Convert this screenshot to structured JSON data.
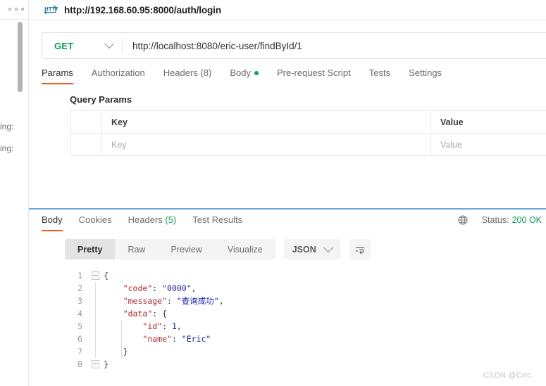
{
  "window": {
    "title": "http://192.168.60.95:8000/auth/login",
    "http_badge_label": "HTTP",
    "rail_menu_icon": "more-horizontal-icon",
    "truncated_left_labels": [
      "ing:",
      "ing:"
    ]
  },
  "request": {
    "method": "GET",
    "url": "http://localhost:8080/eric-user/findById/1",
    "tabs": [
      {
        "label": "Params",
        "active": true,
        "dot": false
      },
      {
        "label": "Authorization",
        "active": false,
        "dot": false
      },
      {
        "label": "Headers (8)",
        "active": false,
        "dot": false
      },
      {
        "label": "Body",
        "active": false,
        "dot": true
      },
      {
        "label": "Pre-request Script",
        "active": false,
        "dot": false
      },
      {
        "label": "Tests",
        "active": false,
        "dot": false
      },
      {
        "label": "Settings",
        "active": false,
        "dot": false
      }
    ],
    "query_params": {
      "section_title": "Query Params",
      "columns": [
        "Key",
        "Value"
      ],
      "rows": [
        {
          "key_placeholder": "Key",
          "value_placeholder": "Value"
        }
      ]
    }
  },
  "response": {
    "tabs": [
      {
        "label": "Body",
        "active": true
      },
      {
        "label": "Cookies",
        "active": false
      },
      {
        "label": "Headers",
        "count": "(5)",
        "active": false
      },
      {
        "label": "Test Results",
        "active": false
      }
    ],
    "status_label": "Status:",
    "status_code": "200 OK",
    "globe_icon": "globe-icon",
    "view_modes": [
      {
        "label": "Pretty",
        "active": true
      },
      {
        "label": "Raw",
        "active": false
      },
      {
        "label": "Preview",
        "active": false
      },
      {
        "label": "Visualize",
        "active": false
      }
    ],
    "format": "JSON",
    "wrap_icon": "wrap-text-icon",
    "code": {
      "line_numbers": [
        "1",
        "2",
        "3",
        "4",
        "5",
        "6",
        "7",
        "8"
      ],
      "lines": [
        [
          {
            "t": "{",
            "c": "p"
          }
        ],
        [
          {
            "t": "    ",
            "c": "p"
          },
          {
            "t": "\"code\"",
            "c": "k"
          },
          {
            "t": ": ",
            "c": "p"
          },
          {
            "t": "\"0000\"",
            "c": "s"
          },
          {
            "t": ",",
            "c": "p"
          }
        ],
        [
          {
            "t": "    ",
            "c": "p"
          },
          {
            "t": "\"message\"",
            "c": "k"
          },
          {
            "t": ": ",
            "c": "p"
          },
          {
            "t": "\"查询成功\"",
            "c": "s"
          },
          {
            "t": ",",
            "c": "p"
          }
        ],
        [
          {
            "t": "    ",
            "c": "p"
          },
          {
            "t": "\"data\"",
            "c": "k"
          },
          {
            "t": ": {",
            "c": "p"
          }
        ],
        [
          {
            "t": "        ",
            "c": "p"
          },
          {
            "t": "\"id\"",
            "c": "k"
          },
          {
            "t": ": ",
            "c": "p"
          },
          {
            "t": "1",
            "c": "n"
          },
          {
            "t": ",",
            "c": "p"
          }
        ],
        [
          {
            "t": "        ",
            "c": "p"
          },
          {
            "t": "\"name\"",
            "c": "k"
          },
          {
            "t": ": ",
            "c": "p"
          },
          {
            "t": "\"Eric\"",
            "c": "s"
          }
        ],
        [
          {
            "t": "    }",
            "c": "p"
          }
        ],
        [
          {
            "t": "}",
            "c": "p"
          }
        ]
      ]
    }
  },
  "watermark": "CSDN @Circ.",
  "colors": {
    "accent_orange": "#ef5b25",
    "method_green": "#0f9d58",
    "status_green": "#0f9d58",
    "splitter_blue": "#65a9dd",
    "json_key": "#a52a2a",
    "json_string": "#1a1aa6"
  }
}
